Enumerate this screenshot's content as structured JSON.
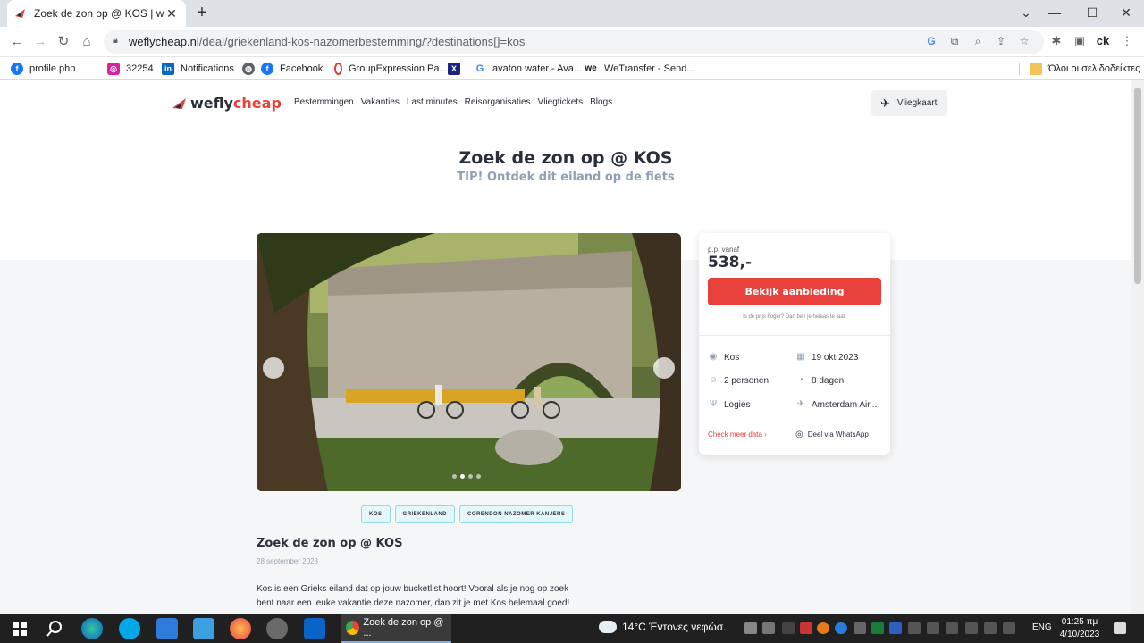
{
  "browser": {
    "tab_title": "Zoek de zon op @ KOS | weflych",
    "tab_close": "✕",
    "new_tab": "+",
    "url_host": "weflycheap.nl",
    "url_path": "/deal/griekenland-kos-nazomerbestemming/?destinations[]=kos",
    "window_controls": {
      "minimize": "—",
      "maximize": "☐",
      "close": "✕",
      "dropdown": "⌄"
    }
  },
  "bookmarks": [
    {
      "label": "profile.php",
      "icon": "facebook-icon",
      "color": "#1877f2"
    },
    {
      "label": "32254",
      "icon": "instagram-icon",
      "color": "#d6249f"
    },
    {
      "label": "Notifications",
      "icon": "linkedin-icon",
      "color": "#0a66c2"
    },
    {
      "label": "Facebook",
      "icon": "facebook-icon",
      "color": "#1877f2"
    },
    {
      "label": "GroupExpression Pa...",
      "icon": "opera-icon",
      "color": "#e53935"
    },
    {
      "label": "avaton water - Ava...",
      "icon": "google-icon",
      "color": "#4285f4"
    },
    {
      "label": "WeTransfer - Send...",
      "icon": "wetransfer-icon",
      "color": "#111111"
    },
    {
      "label": "Όλοι οι σελιδοδείκτες",
      "icon": "folder-icon",
      "color": "#f2c45a"
    }
  ],
  "site": {
    "logo_we": "wefly",
    "logo_cheap": "cheap",
    "nav": [
      "Bestemmingen",
      "Vakanties",
      "Last minutes",
      "Reisorganisaties",
      "Vliegtickets",
      "Blogs"
    ],
    "vliegkaart": "Vliegkaart",
    "brand_red": "#e8403a"
  },
  "deal": {
    "title": "Zoek de zon op @ KOS",
    "subtitle": "TIP! Ontdek dit eiland op de fiets",
    "carousel_dots": 4,
    "carousel_active": 1
  },
  "card": {
    "pp_vanaf": "p.p. vanaf",
    "price": "538,-",
    "cta": "Bekijk aanbieding",
    "note": "Is de prijs hoger? Dan ben je helaas te laat.",
    "destination": "Kos",
    "date": "19 okt 2023",
    "persons": "2 personen",
    "days": "8 dagen",
    "board": "Logies",
    "airport": "Amsterdam Air...",
    "check_more": "Check meer data",
    "whatsapp": "Deel via WhatsApp"
  },
  "tags": [
    "KOS",
    "GRIEKENLAND",
    "CORENDON NAZOMER KANJERS"
  ],
  "article": {
    "title": "Zoek de zon op @ KOS",
    "date": "28 september 2023",
    "body_line1": "Kos is een Grieks eiland dat op jouw bucketlist hoort! Vooral als je nog op zoek",
    "body_line2": "bent naar een leuke vakantie deze nazomer, dan zit je met Kos helemaal goed!"
  },
  "taskbar": {
    "active_window": "Zoek de zon op @ ...",
    "weather": "14°C  Έντονες νεφώσ.",
    "language": "ENG",
    "time": "01:25 πμ",
    "date": "4/10/2023"
  }
}
